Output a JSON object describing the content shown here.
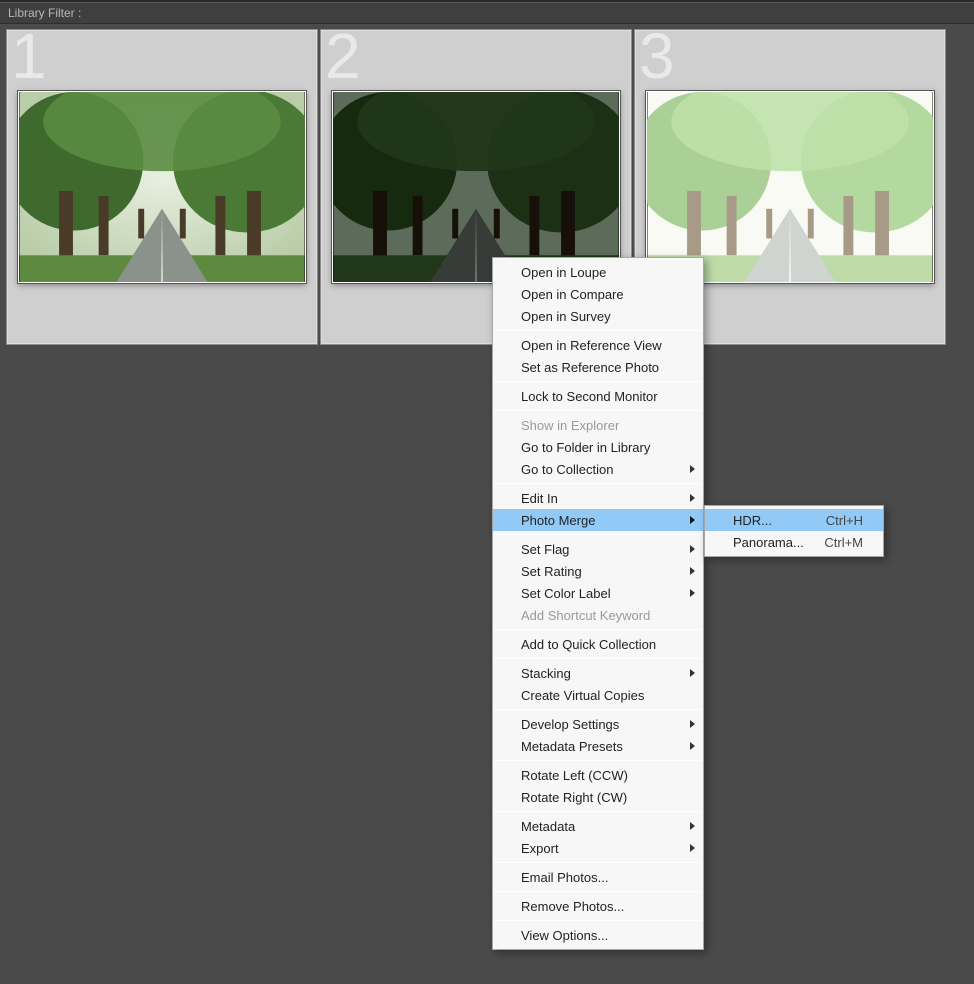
{
  "header": {
    "library_filter_label": "Library Filter :"
  },
  "grid": {
    "cells": [
      {
        "index": "1",
        "exposure": "normal",
        "selected": true
      },
      {
        "index": "2",
        "exposure": "under",
        "selected": true
      },
      {
        "index": "3",
        "exposure": "over",
        "selected": true
      }
    ]
  },
  "context_menu": {
    "items": [
      {
        "label": "Open in Loupe"
      },
      {
        "label": "Open in Compare"
      },
      {
        "label": "Open in Survey"
      },
      {
        "sep": true
      },
      {
        "label": "Open in Reference View"
      },
      {
        "label": "Set as Reference Photo"
      },
      {
        "sep": true
      },
      {
        "label": "Lock to Second Monitor"
      },
      {
        "sep": true
      },
      {
        "label": "Show in Explorer",
        "disabled": true
      },
      {
        "label": "Go to Folder in Library"
      },
      {
        "label": "Go to Collection",
        "submenu": true
      },
      {
        "sep": true
      },
      {
        "label": "Edit In",
        "submenu": true
      },
      {
        "label": "Photo Merge",
        "submenu": true,
        "highlight": true
      },
      {
        "sep": true
      },
      {
        "label": "Set Flag",
        "submenu": true
      },
      {
        "label": "Set Rating",
        "submenu": true
      },
      {
        "label": "Set Color Label",
        "submenu": true
      },
      {
        "label": "Add Shortcut Keyword",
        "disabled": true
      },
      {
        "sep": true
      },
      {
        "label": "Add to Quick Collection"
      },
      {
        "sep": true
      },
      {
        "label": "Stacking",
        "submenu": true
      },
      {
        "label": "Create Virtual Copies"
      },
      {
        "sep": true
      },
      {
        "label": "Develop Settings",
        "submenu": true
      },
      {
        "label": "Metadata Presets",
        "submenu": true
      },
      {
        "sep": true
      },
      {
        "label": "Rotate Left (CCW)"
      },
      {
        "label": "Rotate Right (CW)"
      },
      {
        "sep": true
      },
      {
        "label": "Metadata",
        "submenu": true
      },
      {
        "label": "Export",
        "submenu": true
      },
      {
        "sep": true
      },
      {
        "label": "Email Photos..."
      },
      {
        "sep": true
      },
      {
        "label": "Remove Photos..."
      },
      {
        "sep": true
      },
      {
        "label": "View Options..."
      }
    ]
  },
  "submenu": {
    "items": [
      {
        "label": "HDR...",
        "shortcut": "Ctrl+H",
        "highlight": true
      },
      {
        "label": "Panorama...",
        "shortcut": "Ctrl+M"
      }
    ]
  }
}
